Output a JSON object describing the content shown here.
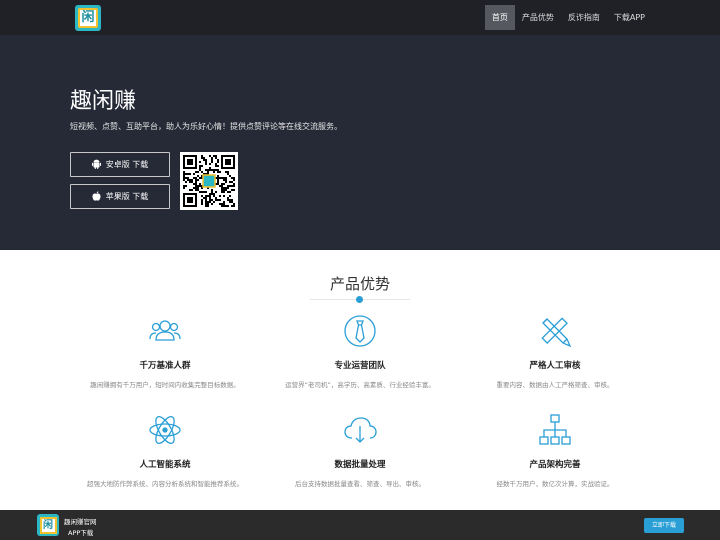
{
  "header": {
    "logo_char": "闲",
    "nav": [
      {
        "label": "首页",
        "active": true
      },
      {
        "label": "产品优势",
        "active": false
      },
      {
        "label": "反诈指南",
        "active": false
      },
      {
        "label": "下载APP",
        "active": false
      }
    ]
  },
  "hero": {
    "title": "趣闲赚",
    "subtitle": "短视频、点赞、互助平台，助人为乐好心情！提供点赞评论等在线交流服务。",
    "android_label": "安卓版 下载",
    "ios_label": "苹果版 下载"
  },
  "section": {
    "title": "产品优势"
  },
  "features": [
    {
      "icon": "people-icon",
      "name": "千万基准人群",
      "desc": "趣闲赚拥有千万用户，短时间内收集完整目标数据。"
    },
    {
      "icon": "tie-icon",
      "name": "专业运营团队",
      "desc": "运营界“老司机”，高学历、高素质、行业经验丰富。"
    },
    {
      "icon": "pencil-ruler-icon",
      "name": "严格人工审核",
      "desc": "重要内容、数据由人工严格筛查、审核。"
    },
    {
      "icon": "atom-icon",
      "name": "人工智能系统",
      "desc": "超强大地防作弊系统、内容分析系统和智能推荐系统。"
    },
    {
      "icon": "cloud-download-icon",
      "name": "数据批量处理",
      "desc": "后台支持数据批量查看、筛查、导出、审核。"
    },
    {
      "icon": "sitemap-icon",
      "name": "产品架构完善",
      "desc": "经数千万用户，数亿次计算，实战验证。"
    }
  ],
  "footer": {
    "logo_char": "闲",
    "line1": "趣闲赚官网",
    "line2": "APP下载",
    "button": "立即下载"
  },
  "colors": {
    "accent": "#2a9fd6",
    "hero_bg": "#262a37",
    "topbar_bg": "#1f2126"
  }
}
